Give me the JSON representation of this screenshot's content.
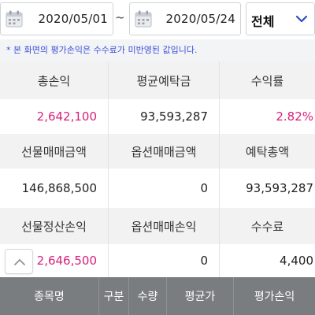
{
  "date_filter": {
    "start_date": "2020/05/01",
    "separator": "~",
    "end_date": "2020/05/24",
    "scope_selected": "전체"
  },
  "notice": "* 본 화면의 평가손익은 수수료가 미반영된 값입니다.",
  "summary": {
    "row1_labels": [
      "총손익",
      "평균예탁금",
      "수익률"
    ],
    "row1_values": [
      "2,642,100",
      "93,593,287",
      "2.82%"
    ],
    "row2_labels": [
      "선물매매금액",
      "옵션매매금액",
      "예탁총액"
    ],
    "row2_values": [
      "146,868,500",
      "0",
      "93,593,287"
    ],
    "row3_labels": [
      "선물정산손익",
      "옵션매매손익",
      "수수료"
    ],
    "row3_values": [
      "2,646,500",
      "0",
      "4,400"
    ]
  },
  "table": {
    "columns": [
      "종목명",
      "구분",
      "수량",
      "평균가",
      "평가손익"
    ]
  },
  "colors": {
    "positive": "#d9207a",
    "header_bg": "#7a7d80",
    "notice_text": "#3b4fd8"
  },
  "icons": {
    "calendar": "calendar-icon",
    "dropdown": "chevron-down-icon",
    "scroll_top": "chevron-up-icon"
  }
}
